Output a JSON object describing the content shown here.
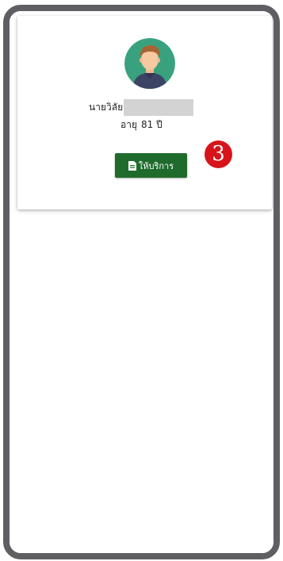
{
  "patient": {
    "name": "นายวิลัย",
    "age_label": "อายุ",
    "age_value": "81 ปี"
  },
  "actions": {
    "service_label": "ให้บริการ"
  },
  "annotation": {
    "step_number": "3"
  },
  "colors": {
    "button_green": "#1f6b2c",
    "badge_red": "#d7141b",
    "avatar_bg": "#3aa17e",
    "frame": "#5f5f63"
  },
  "icons": {
    "avatar": "user-avatar-icon",
    "service": "document-icon"
  }
}
